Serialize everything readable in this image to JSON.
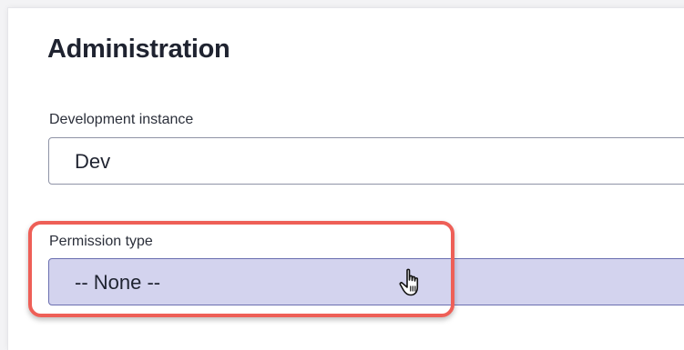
{
  "section": {
    "title": "Administration"
  },
  "fields": {
    "development_instance": {
      "label": "Development instance",
      "value": "Dev"
    },
    "permission_type": {
      "label": "Permission type",
      "selected": "-- None --"
    }
  },
  "colors": {
    "highlight": "#ee5f57",
    "select_background": "#d3d3ee",
    "select_border": "#6b6fb0"
  },
  "icons": {
    "cursor": "hand-pointer-icon"
  }
}
